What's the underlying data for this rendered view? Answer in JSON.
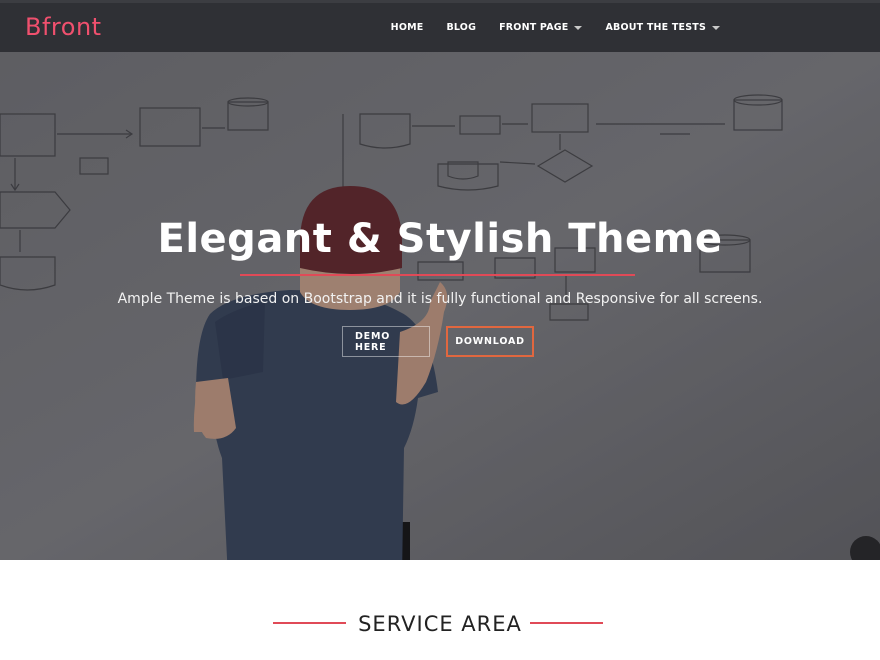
{
  "header": {
    "logo": "Bfront",
    "nav": [
      {
        "label": "HOME",
        "dropdown": false
      },
      {
        "label": "BLOG",
        "dropdown": false
      },
      {
        "label": "FRONT PAGE",
        "dropdown": true
      },
      {
        "label": "ABOUT THE TESTS",
        "dropdown": true
      }
    ]
  },
  "hero": {
    "title": "Elegant & Stylish Theme",
    "subtitle": "Ample Theme is based on Bootstrap and it is fully functional and Responsive for all screens.",
    "demo_button": "DEMO HERE",
    "download_button": "DOWNLOAD"
  },
  "service": {
    "title": "SERVICE AREA"
  },
  "colors": {
    "brand": "#f0506e",
    "header_bg": "#2f3035",
    "accent_line": "#e04a57",
    "download_border": "#e1673f"
  }
}
